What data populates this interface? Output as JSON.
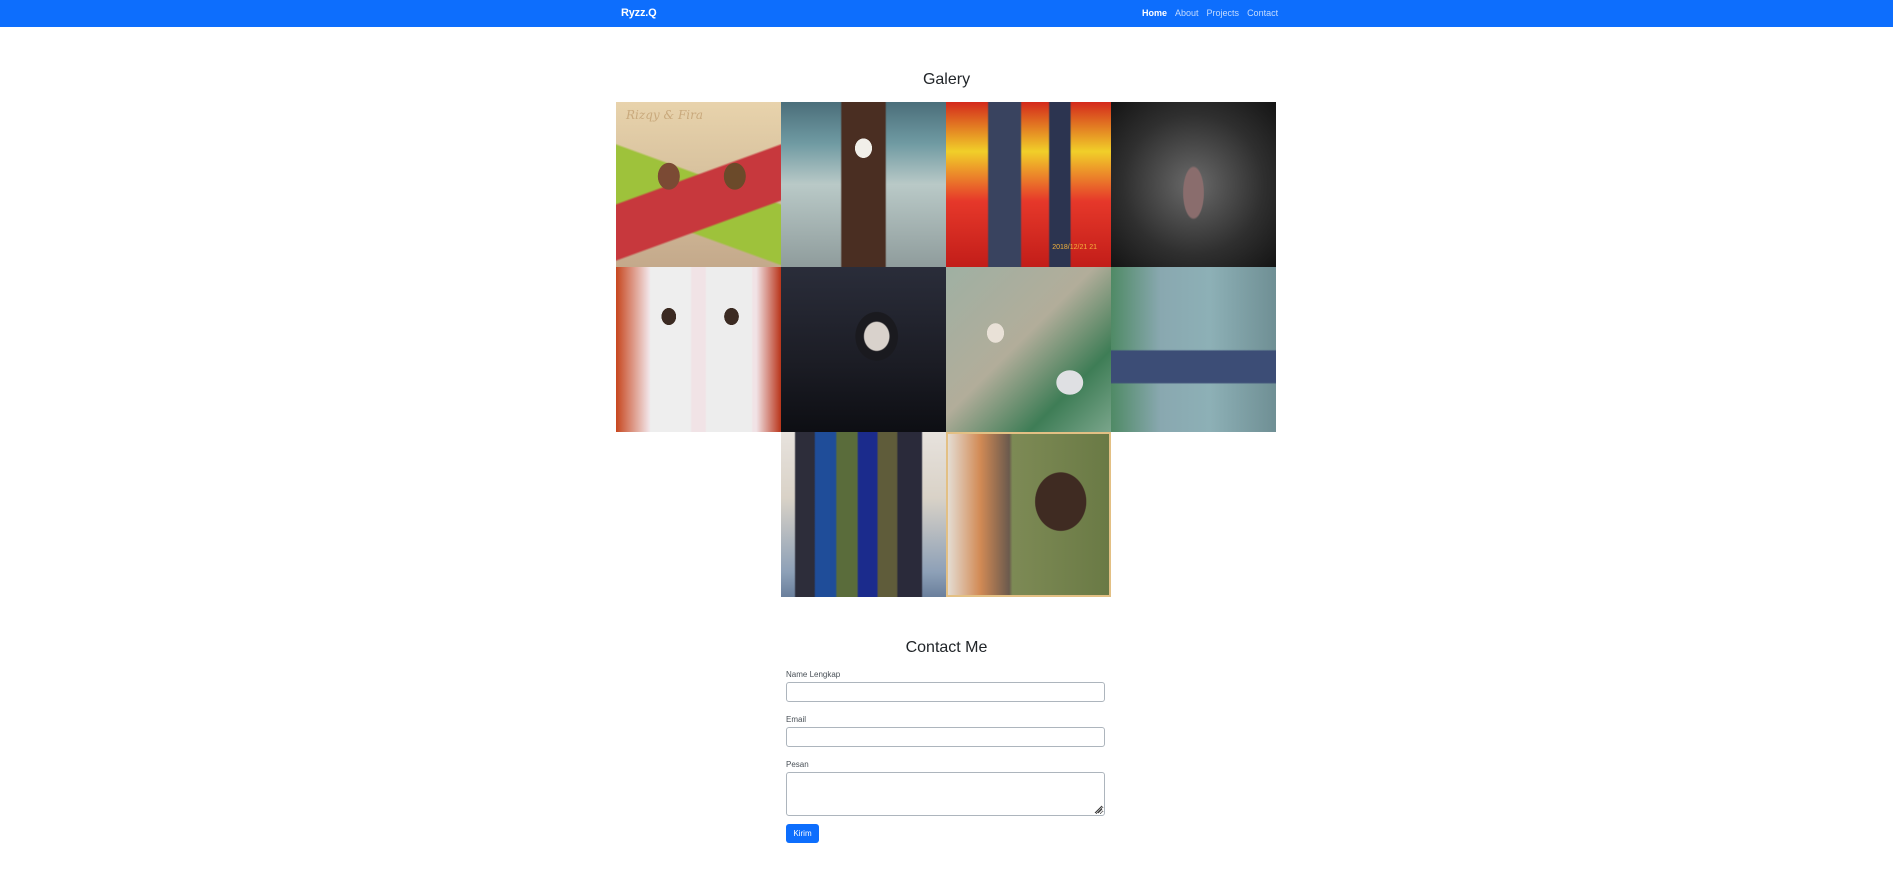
{
  "navbar": {
    "brand": "Ryzz.Q",
    "links": [
      {
        "label": "Home",
        "active": true
      },
      {
        "label": "About",
        "active": false
      },
      {
        "label": "Projects",
        "active": false
      },
      {
        "label": "Contact",
        "active": false
      }
    ],
    "background_color": "#0d6efd"
  },
  "gallery": {
    "title": "Galery",
    "photos": [
      {
        "overlay_text": "Rizqy & Fira"
      },
      {
        "overlay_text": ""
      },
      {
        "overlay_text": "2018/12/21 21"
      },
      {
        "overlay_text": ""
      },
      {
        "overlay_text": ""
      },
      {
        "overlay_text": ""
      },
      {
        "overlay_text": ""
      },
      {
        "overlay_text": ""
      },
      {
        "overlay_text": ""
      },
      {
        "overlay_text": ""
      }
    ]
  },
  "contact": {
    "title": "Contact Me",
    "name_label": "Name Lengkap",
    "name_value": "",
    "email_label": "Email",
    "email_value": "",
    "message_label": "Pesan",
    "message_value": "",
    "submit_label": "Kirim"
  }
}
